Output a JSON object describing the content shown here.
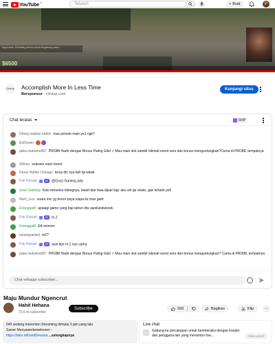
{
  "header": {
    "logo_text": "YouTube",
    "country": "ID",
    "search_placeholder": "Telusuri",
    "create_label": "Buat",
    "avatar_initial": "P"
  },
  "video": {
    "overlay_money": "$6500",
    "banner_text": "Sapa tamu: Kilomberg semua dunia tergantung pada..."
  },
  "ad": {
    "logo_text": "ClickUp",
    "title": "Accomplish More In Less Time",
    "sponsor_label": "Bersponsor",
    "sponsor_domain": "clickup.com",
    "cta": "Kunjungi situs"
  },
  "chat": {
    "mode": "Chat teratas",
    "points": "0XP",
    "input_placeholder": "Chat sebagai subscriber...",
    "messages": [
      {
        "author": "Dhany waldan hafizh",
        "text": "mas pernah main ps1 ngk?",
        "av_color": "#8d6e63",
        "author_type": "normal"
      },
      {
        "author": "EsDream",
        "text": "",
        "av_color": "#5d8f4f",
        "author_type": "normal",
        "emojis": [
          "#e05a2b",
          "#7a58c8"
        ]
      },
      {
        "author": "paka mulutmu987",
        "text": "PRO88 Hadir dengan Bonus Paling Gila! ⚡ Mau main slot sambil nikmati event seru dan bonus menguntungkan?Cuma di PRO88, tempatnya",
        "av_color": "#6b4e3d",
        "author_type": "normal"
      },
      {
        "author": "Zidnuu",
        "text": "suarane sopo booor",
        "av_color": "#9e9e9e",
        "author_type": "normal"
      },
      {
        "author": "Dezar Hafidz Chniago",
        "text": "terus dlc nya beli lgi wkwk",
        "av_color": "#c26a4a",
        "author_type": "normal"
      },
      {
        "author": "Pak Rukadi",
        "tag": "#2",
        "text": "@Grazi Gaming ada",
        "av_color": "#7d5d4a",
        "author_type": "mod"
      },
      {
        "author": "Grazi Gaming",
        "text": "Kalo temenku bilangnya, kaset biar biaa dijual lagi. aku sih ga relate, gak tertarik ps5",
        "av_color": "#1a7f37",
        "author_type": "member"
      },
      {
        "author": "Nutri_Lion",
        "text": "suara mic yg booor pnya siapa itu mas garit",
        "av_color": "#bdbdbd",
        "author_type": "normal"
      },
      {
        "author": "ErlanggaM",
        "text": "apalagi game yang tiap tahun rilis awokwokwowk",
        "av_color": "#43a047",
        "author_type": "member"
      },
      {
        "author": "Pak Rukadi",
        "tag": "#2",
        "text": "m.2",
        "av_color": "#7d5d4a",
        "author_type": "mod"
      },
      {
        "author": "ErlanggaM",
        "text": "EA momen",
        "av_color": "#43a047",
        "author_type": "member"
      },
      {
        "author": "tukangsanted",
        "text": "m2?",
        "av_color": "#5c3b2e",
        "author_type": "normal"
      },
      {
        "author": "Pak Rukadi",
        "tag": "#2",
        "text": "asal tipe m.2 nya sama",
        "av_color": "#7d5d4a",
        "author_type": "mod"
      },
      {
        "author": "paka mulutmu987",
        "text": "PRO88 Hadir dengan Bonus Paling Gila! ⚡ Mau main slot sambil nikmati event seru dan bonus menguntungkan? Cuma di PRO88, tempatnya",
        "av_color": "#6b4e3d",
        "author_type": "normal"
      }
    ]
  },
  "video_info": {
    "title": "Maju Mundur Ngencrut",
    "channel_name": "Hahit Hehana",
    "subscribers": "72,6 rb subscriber",
    "subscribe_label": "Subscribe",
    "likes": "293",
    "share_label": "Bagikan",
    "clip_label": "Klip"
  },
  "description": {
    "line1": "540 sedang menonton  Streaming dimulai 3 jam yang lalu",
    "line2": "Sawer Menyawerkewekewer :",
    "link": "https://tako.id/GaritDewana",
    "more": "...selengkapnya"
  },
  "live_chat_panel": {
    "title": "Live chat",
    "text": "Gabung ke percakapan untuk berinteraksi dengan kreator dan pengguna lain yang menonton live...",
    "button": "Buka panel"
  }
}
